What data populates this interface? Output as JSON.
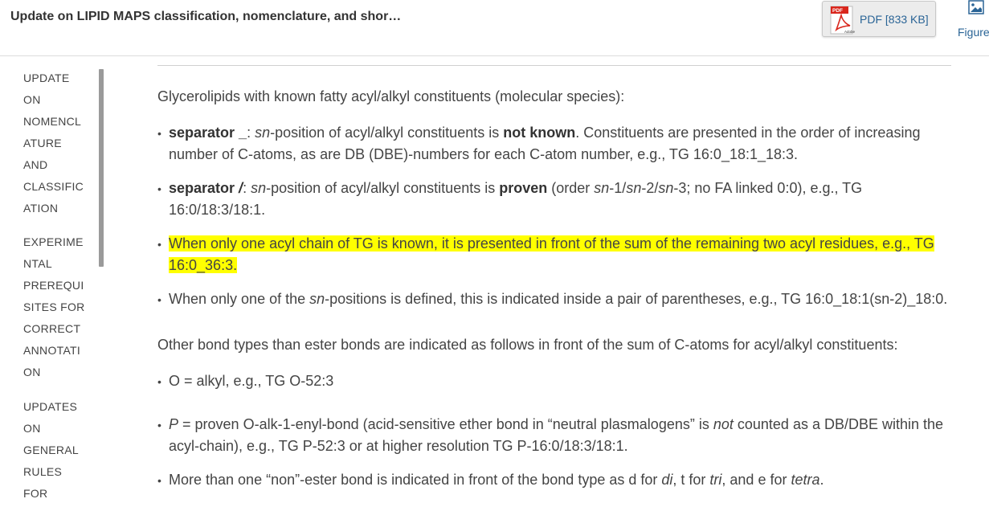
{
  "header": {
    "title": "Update on LIPID MAPS classification, nomenclature, and shor…",
    "pdf_label": "PDF [833 KB]",
    "figures_label": "Figures"
  },
  "sidebar": {
    "toc": [
      [
        "UPDATE",
        "ON",
        "NOMENCL",
        "ATURE",
        "AND",
        "CLASSIFIC",
        "ATION"
      ],
      [
        "EXPERIME",
        "NTAL",
        "PREREQUI",
        "SITES FOR",
        "CORRECT",
        "ANNOTATI",
        "ON"
      ],
      [
        "UPDATES",
        "ON",
        "GENERAL",
        "RULES",
        "FOR"
      ]
    ]
  },
  "content": {
    "intro": "Glycerolipids with known fatty acyl/alkyl constituents (molecular species):",
    "b1": {
      "l1_a": "separator _",
      "l1_b": ": ",
      "l1_c": "sn",
      "l1_d": "-position of acyl/alkyl constituents is ",
      "l1_e": "not known",
      "l1_f": ". Constituents are presented in the order of increasing",
      "l2": "number of C-atoms, as are DB (DBE)-numbers for each C-atom number, e.g., TG 16:0_18:1_18:3."
    },
    "b2": {
      "l1_a": "separator ",
      "l1_b": "/",
      "l1_c": ": ",
      "l1_d": "sn",
      "l1_e": "-position of acyl/alkyl constituents is ",
      "l1_f": "proven",
      "l1_g": " (order ",
      "l1_h": "sn",
      "l1_i": "-1/",
      "l1_j": "sn",
      "l1_k": "-2/",
      "l1_l": "sn",
      "l1_m": "-3; no FA linked 0:0), e.g., TG",
      "l2": "16:0/18:3/18:1."
    },
    "b3": {
      "l1": "When only one acyl chain of TG is known, it is presented in front of the sum of the remaining two acyl residues, e.g., TG",
      "l2": "16:0_36:3."
    },
    "b4": {
      "l1_a": "When only one of the ",
      "l1_b": "sn",
      "l1_c": "-positions is defined, this is indicated inside a pair of parentheses, e.g., TG 16:0_18:1(sn-2)_18:0."
    },
    "para2": "Other bond types than ester bonds are indicated as follows in front of the sum of C-atoms for acyl/alkyl constituents:",
    "b5": "O = alkyl, e.g., TG O-52:3",
    "b6": {
      "l1_a": "P",
      "l1_b": " = proven O-alk-1-enyl-bond (acid-sensitive ether bond in “neutral plasmalogens” is ",
      "l1_c": "not",
      "l1_d": " counted as a DB/DBE within the",
      "l2": "acyl-chain), e.g., TG P-52:3 or at higher resolution TG P-16:0/18:3/18:1."
    },
    "b7": {
      "a": "More than one “non”-ester bond is indicated in front of the bond type as d for ",
      "b": "di",
      "c": ", t for ",
      "d": "tri",
      "e": ", and e for ",
      "f": "tetra",
      "g": "."
    }
  },
  "colors": {
    "highlight": "#ffff00",
    "link": "#2a6496",
    "pdf_red": "#d9261c"
  },
  "icons": [
    "pdf-icon",
    "figure-image-icon"
  ]
}
